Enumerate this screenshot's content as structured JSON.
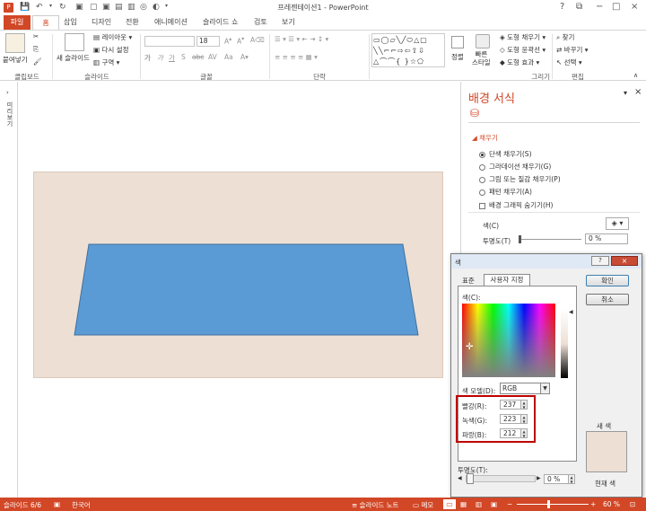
{
  "titlebar": {
    "title": "프레젠테이션1 - PowerPoint",
    "help": "?",
    "restore": "⧉",
    "minimize": "−",
    "maximize": "□",
    "close": "×"
  },
  "tabs": [
    "파일",
    "홈",
    "삽입",
    "디자인",
    "전환",
    "애니메이션",
    "슬라이드 쇼",
    "검토",
    "보기"
  ],
  "ribbon": {
    "clipboard": {
      "paste": "붙여넣기",
      "group": "클립보드"
    },
    "slides": {
      "new_slide": "새 슬라이드",
      "layout": "레이아웃",
      "reset": "다시 설정",
      "section": "구역",
      "group": "슬라이드"
    },
    "font": {
      "size": "18",
      "group": "글꼴",
      "bold": "가",
      "italic": "가",
      "underline": "가",
      "shadow": "S",
      "strike": "abc",
      "spacing": "AV",
      "case": "Aa"
    },
    "paragraph": {
      "group": "단락"
    },
    "drawing": {
      "arrange": "정렬",
      "quick_styles": "빠른\n스타일",
      "fill": "도형 채우기",
      "outline": "도형 윤곽선",
      "effects": "도형 효과",
      "group": "그리기"
    },
    "editing": {
      "find": "찾기",
      "replace": "바꾸기",
      "select": "선택",
      "group": "편집"
    }
  },
  "slide_panel": {
    "label": "미리보기"
  },
  "pane": {
    "title": "배경 서식",
    "section": "채우기",
    "options": [
      "단색 채우기(S)",
      "그라데이션 채우기(G)",
      "그림 또는 질감 채우기(P)",
      "패턴 채우기(A)"
    ],
    "selected_option": 0,
    "hide_bg": "배경 그래픽 숨기기(H)",
    "color_label": "색(C)",
    "transparency_label": "투명도(T)",
    "transparency_value": "0 %"
  },
  "dialog": {
    "title": "색",
    "help": "?",
    "tab_standard": "표준",
    "tab_custom": "사용자 지정",
    "colors_label": "색(C):",
    "model_label": "색 모델(D):",
    "model_value": "RGB",
    "red_label": "빨강(R):",
    "red": "237",
    "green_label": "녹색(G):",
    "green": "223",
    "blue_label": "파랑(B):",
    "blue": "212",
    "transparency_label": "투명도(T):",
    "transparency_value": "0 %",
    "ok": "확인",
    "cancel": "취소",
    "new_label": "새 색",
    "current_label": "현재 색",
    "new_color": "#eddfd4",
    "current_color": "#eddfd4"
  },
  "status": {
    "slide": "슬라이드 6/6",
    "lang": "한국어",
    "notes": "슬라이드 노트",
    "memo": "메모",
    "zoom": "60 %"
  },
  "colors": {
    "accent": "#d24726",
    "shape": "#5b9bd5",
    "background": "#eddfd4",
    "highlight": "#c00000"
  }
}
